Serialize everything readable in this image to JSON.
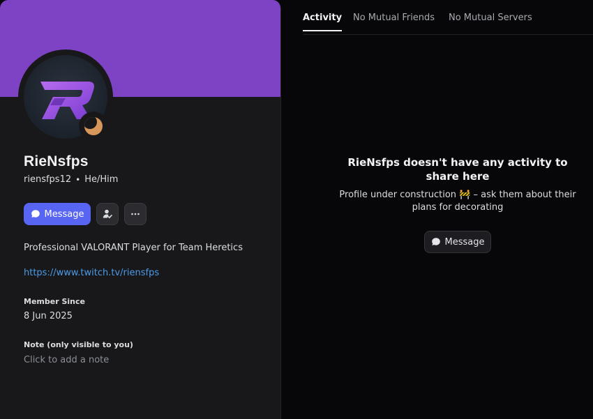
{
  "profile": {
    "display_name": "RieNsfps",
    "username": "riensfps12",
    "separator": "•",
    "pronouns": "He/Him",
    "status": "idle",
    "banner_color": "#7e42c5",
    "accent_color": "#5865f2",
    "avatar_icon": "logo-r-icon",
    "bio": "Professional VALORANT Player for Team Heretics",
    "link": "https://www.twitch.tv/riensfps",
    "member_since_label": "Member Since",
    "member_since_value": "8 Jun 2025",
    "note_label": "Note (only visible to you)",
    "note_placeholder": "Click to add a note"
  },
  "actions": {
    "message_label": "Message",
    "friend_icon": "add-friend-icon",
    "more_icon": "more-icon"
  },
  "tabs": [
    {
      "label": "Activity",
      "active": true
    },
    {
      "label": "No Mutual Friends",
      "active": false
    },
    {
      "label": "No Mutual Servers",
      "active": false
    }
  ],
  "activity": {
    "title": "RieNsfps doesn't have any activity to share here",
    "subtitle": "Profile under construction 🚧 – ask them about their plans for decorating",
    "button_label": "Message"
  }
}
